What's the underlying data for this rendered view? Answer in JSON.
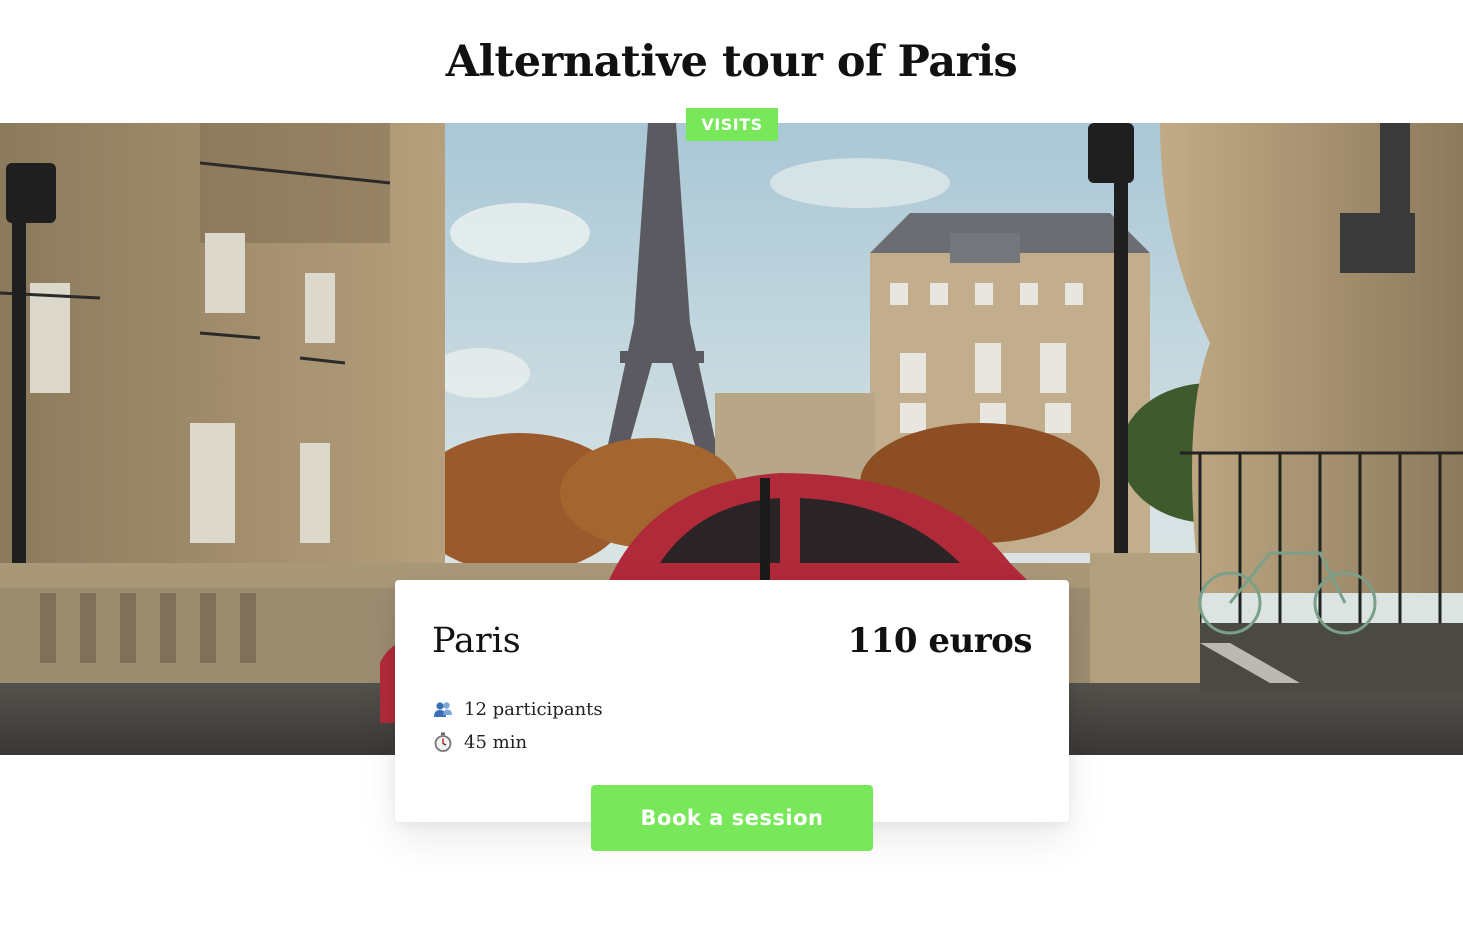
{
  "page": {
    "title": "Alternative tour of Paris"
  },
  "category": {
    "label": "VISITS"
  },
  "card": {
    "city": "Paris",
    "price": "110 euros",
    "participants": "12 participants",
    "duration": "45 min",
    "participants_icon": "people-icon",
    "duration_icon": "stopwatch-icon"
  },
  "actions": {
    "book_label": "Book a session"
  },
  "colors": {
    "accent": "#78e85a",
    "text": "#111111",
    "background": "#ffffff"
  }
}
